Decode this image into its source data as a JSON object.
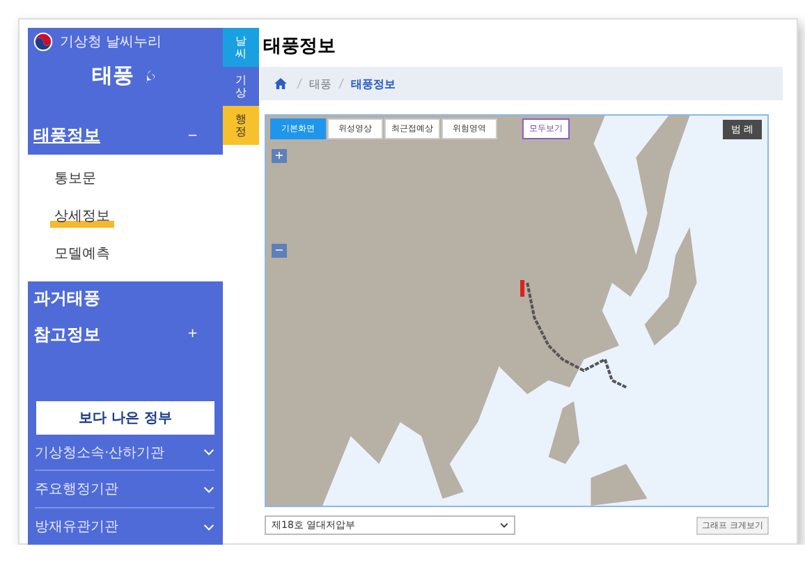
{
  "sidebar": {
    "agency": "기상청 날씨누리",
    "title": "태풍",
    "menu": [
      {
        "label": "태풍정보",
        "expanded": true,
        "toggle": "−",
        "children": [
          {
            "label": "통보문",
            "selected": false
          },
          {
            "label": "상세정보",
            "selected": true
          },
          {
            "label": "모델예측",
            "selected": false
          }
        ]
      },
      {
        "label": "과거태풍",
        "expanded": false
      },
      {
        "label": "참고정보",
        "expanded": false,
        "toggle": "+"
      }
    ],
    "banner": "보다 나은 정부",
    "links": [
      "기상청소속·산하기관",
      "주요행정기관",
      "방재유관기관"
    ]
  },
  "side_tabs": [
    {
      "label": "날씨",
      "kind": "weather"
    },
    {
      "label": "기상",
      "kind": "meteo"
    },
    {
      "label": "행정",
      "kind": "admin"
    }
  ],
  "page_title": "태풍정보",
  "breadcrumb": [
    {
      "label": "태풍",
      "current": false
    },
    {
      "label": "태풍정보",
      "current": true
    }
  ],
  "map": {
    "layers": [
      {
        "label": "기본화면",
        "selected": true
      },
      {
        "label": "위성영상",
        "selected": false
      },
      {
        "label": "최근접예상",
        "selected": false
      },
      {
        "label": "위험영역",
        "selected": false
      }
    ],
    "show_all": "모두보기",
    "legend": "범 례",
    "zoom_in": "+",
    "zoom_out": "−"
  },
  "typhoon_select": {
    "value": "제18호 열대저압부"
  },
  "graph_button": "그래프 크게보기"
}
